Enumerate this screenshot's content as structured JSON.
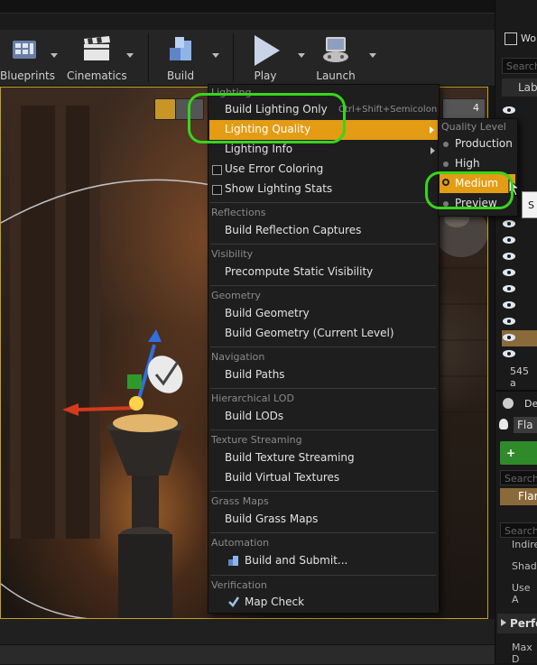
{
  "toolbar": {
    "blueprints_label": "Blueprints",
    "cinematics_label": "Cinematics",
    "build_label": "Build",
    "play_label": "Play",
    "launch_label": "Launch"
  },
  "viewport": {
    "camera_speed": "4"
  },
  "menu": {
    "lighting_header": "Lighting",
    "build_lighting_only": "Build Lighting Only",
    "build_lighting_only_shortcut": "Ctrl+Shift+Semicolon",
    "lighting_quality": "Lighting Quality",
    "lighting_info": "Lighting Info",
    "use_error_coloring": "Use Error Coloring",
    "show_lighting_stats": "Show Lighting Stats",
    "reflections_header": "Reflections",
    "build_reflection_captures": "Build Reflection Captures",
    "visibility_header": "Visibility",
    "precompute_static_visibility": "Precompute Static Visibility",
    "geometry_header": "Geometry",
    "build_geometry": "Build Geometry",
    "build_geometry_current": "Build Geometry (Current Level)",
    "navigation_header": "Navigation",
    "build_paths": "Build Paths",
    "hlod_header": "Hierarchical LOD",
    "build_lods": "Build LODs",
    "texture_streaming_header": "Texture Streaming",
    "build_texture_streaming": "Build Texture Streaming",
    "build_virtual_textures": "Build Virtual Textures",
    "grass_maps_header": "Grass Maps",
    "build_grass_maps": "Build Grass Maps",
    "automation_header": "Automation",
    "build_and_submit": "Build and Submit...",
    "verification_header": "Verification",
    "map_check": "Map Check"
  },
  "submenu": {
    "header": "Quality Level",
    "items": [
      "Production",
      "High",
      "Medium",
      "Preview"
    ],
    "selected": "Medium"
  },
  "right_panel": {
    "world_outliner_tab": "Wo",
    "search_placeholder": "Search",
    "label_column": "Lab",
    "actor_count": "545 a",
    "details_tab": "De",
    "selected_actor": "Fla",
    "add_button": "+ Add",
    "search2_placeholder": "Search",
    "component_name": "Flar",
    "search3_placeholder": "Search",
    "prop_indirect": "Indire",
    "prop_shadow": "Shado",
    "prop_use": "Use A",
    "perf_section": "Perfo",
    "prop_max": "Max D"
  },
  "tooltip": "S",
  "colors": {
    "highlight": "#e39c14",
    "annotation_ring": "#37d51c",
    "viewport_border": "#c2a024"
  }
}
